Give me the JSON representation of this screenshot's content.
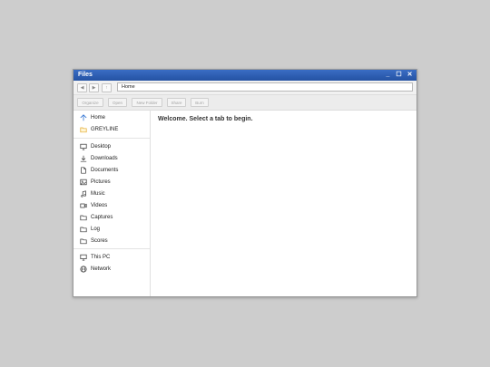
{
  "window": {
    "title": "Files",
    "controls": {
      "minimize": "_",
      "maximize": "☐",
      "close": "✕"
    }
  },
  "address": {
    "back": "◀",
    "forward": "▶",
    "up": "↑",
    "path": "Home"
  },
  "toolbar": {
    "organize": "Organize",
    "open": "Open",
    "new_folder": "New Folder",
    "share": "Share",
    "burn": "Burn"
  },
  "sidebar": {
    "home": "Home",
    "user": "GREYLINE",
    "desktop": "Desktop",
    "downloads": "Downloads",
    "documents": "Documents",
    "pictures": "Pictures",
    "music": "Music",
    "videos": "Videos",
    "captures": "Captures",
    "log": "Log",
    "scores": "Scores",
    "this_pc": "This PC",
    "network": "Network"
  },
  "content": {
    "welcome": "Welcome. Select a tab to begin."
  },
  "colors": {
    "titlebar": "#2a5db3",
    "folder_accent": "#e3a82b",
    "home_accent": "#2b6fd1"
  }
}
